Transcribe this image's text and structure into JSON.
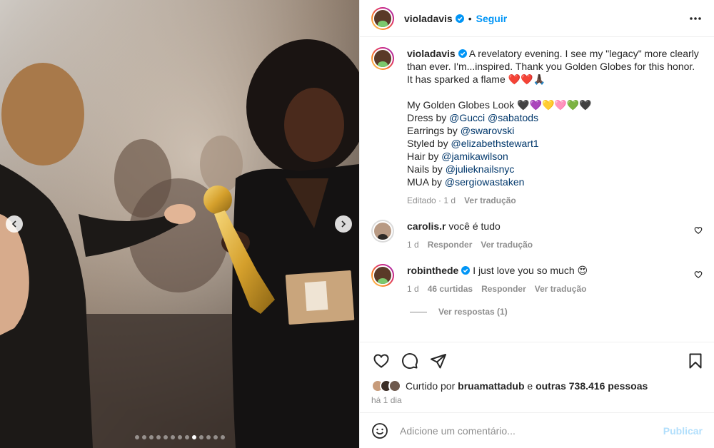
{
  "post": {
    "author": "violadavis",
    "follow_label": "Seguir",
    "separator": "•",
    "caption": "A revelatory evening. I see my \"legacy\" more clearly than ever. I'm...inspired. Thank you Golden Globes for this honor. It has sparked a flame ❤️❤️🙏🏿",
    "look_title": "My Golden Globes Look 🖤💜💛🩷💚🖤",
    "credits": [
      {
        "label": "Dress by ",
        "handles": "@Gucci @sabatods"
      },
      {
        "label": "Earrings by ",
        "handles": "@swarovski"
      },
      {
        "label": "Styled by ",
        "handles": "@elizabethstewart1"
      },
      {
        "label": "Hair by ",
        "handles": "@jamikawilson"
      },
      {
        "label": "Nails by ",
        "handles": "@julieknailsnyc"
      },
      {
        "label": "MUA by ",
        "handles": "@sergiowastaken"
      }
    ],
    "edited": "Editado",
    "edited_time": "1 d",
    "see_translation": "Ver tradução"
  },
  "comments": [
    {
      "user": "carolis.r",
      "verified": false,
      "text": "você é tudo",
      "time": "1 d",
      "likes": "",
      "reply": "Responder",
      "translate": "Ver tradução"
    },
    {
      "user": "robinthede",
      "verified": true,
      "text": "I just love you so much 😍",
      "time": "1 d",
      "likes": "46 curtidas",
      "reply": "Responder",
      "translate": "Ver tradução"
    }
  ],
  "view_replies": "Ver respostas (1)",
  "likes": {
    "prefix": "Curtido por ",
    "user": "bruamattadub",
    "middle": " e ",
    "others": "outras 738.416 pessoas"
  },
  "posted_ago": "há 1 dia",
  "add_comment": {
    "placeholder": "Adicione um comentário...",
    "post_label": "Publicar"
  },
  "carousel": {
    "total": 13,
    "active": 9
  },
  "colors": {
    "accent": "#0095f6",
    "text": "#262626",
    "muted": "#8e8e8e",
    "link": "#00376b"
  },
  "icons": [
    "more-icon",
    "verified-icon",
    "heart-icon",
    "comment-icon",
    "share-icon",
    "save-icon",
    "emoji-icon",
    "chevron-left-icon",
    "chevron-right-icon"
  ]
}
